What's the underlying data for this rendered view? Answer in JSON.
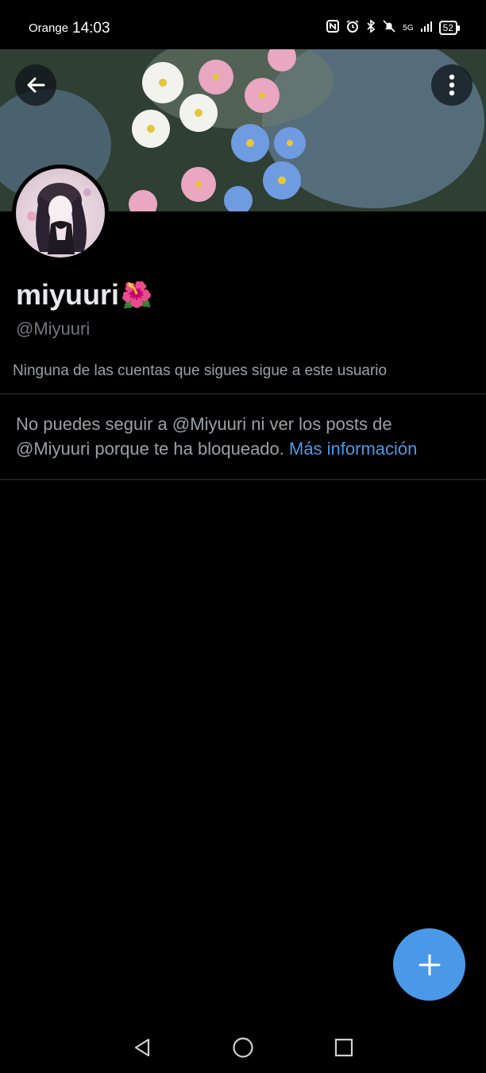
{
  "status_bar": {
    "carrier": "Orange",
    "time": "14:03",
    "network": "5G",
    "battery": "52"
  },
  "profile": {
    "display_name": "miyuuri",
    "display_emoji": "🌺",
    "handle": "@Miyuuri",
    "followers_note": "Ninguna de las cuentas que sigues sigue a este usuario"
  },
  "blocked": {
    "message": "No puedes seguir a @Miyuuri ni ver los posts de @Miyuuri porque te ha bloqueado. ",
    "link": "Más información"
  },
  "icons": {
    "back": "back-arrow-icon",
    "more": "more-vertical-icon",
    "compose": "plus-icon",
    "nav_back": "triangle-back-icon",
    "nav_home": "circle-home-icon",
    "nav_recents": "square-recents-icon"
  },
  "colors": {
    "background": "#000000",
    "accent": "#4a99e9",
    "secondary_text": "#71767b",
    "divider": "#2f3336"
  }
}
